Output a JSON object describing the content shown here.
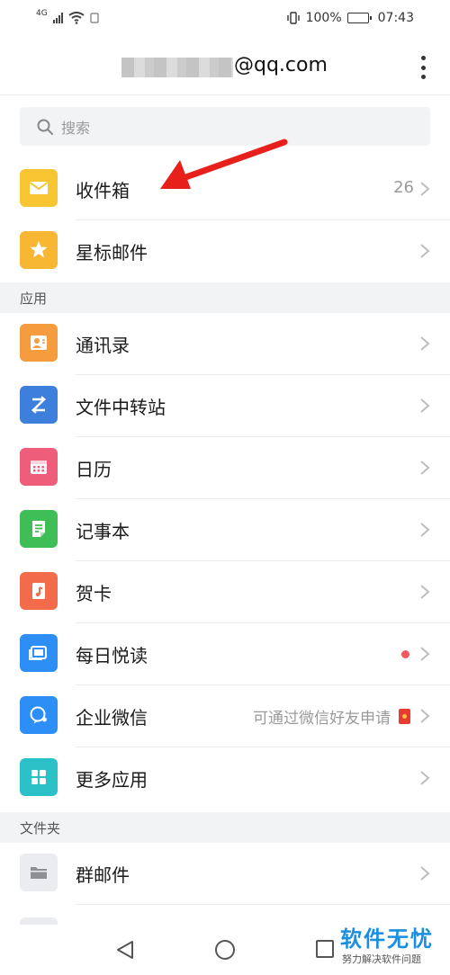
{
  "status_bar": {
    "network": "4G",
    "battery_percent": "100%",
    "time": "07:43"
  },
  "header": {
    "email_suffix": "@qq.com",
    "more_icon": "more-vertical-icon"
  },
  "search": {
    "placeholder": "搜索"
  },
  "mailbox": [
    {
      "label": "收件箱",
      "count": "26",
      "icon": "envelope-icon",
      "color": "#f6c531"
    },
    {
      "label": "星标邮件",
      "icon": "star-icon",
      "color": "#f7b733"
    }
  ],
  "apps_section": {
    "title": "应用",
    "items": [
      {
        "label": "通讯录",
        "icon": "contact-card-icon",
        "color": "#f49c3e"
      },
      {
        "label": "文件中转站",
        "icon": "transfer-icon",
        "color": "#3f7fdc"
      },
      {
        "label": "日历",
        "icon": "calendar-icon",
        "color": "#ee5d7a"
      },
      {
        "label": "记事本",
        "icon": "notepad-icon",
        "color": "#3fbd57"
      },
      {
        "label": "贺卡",
        "icon": "greeting-card-icon",
        "color": "#f26b4b"
      },
      {
        "label": "每日悦读",
        "icon": "reading-icon",
        "color": "#2d8ef5",
        "badge": "red-dot",
        "badge_color": "#f05a5a"
      },
      {
        "label": "企业微信",
        "icon": "wecom-icon",
        "color": "#2d8ef5",
        "hint": "可通过微信好友申请",
        "hint_icon": "red-envelope-icon"
      },
      {
        "label": "更多应用",
        "icon": "grid-icon",
        "color": "#2cc0c7"
      }
    ]
  },
  "folders_section": {
    "title": "文件夹",
    "items": [
      {
        "label": "群邮件",
        "icon": "folder-icon",
        "color": "#ebecef"
      }
    ]
  },
  "nav_bar": {
    "back_icon": "back-triangle-icon",
    "home_icon": "home-circle-icon",
    "recents_icon": "recents-square-icon"
  },
  "watermark": {
    "title": "软件无忧",
    "subtitle": "努力解决软件问题"
  },
  "annotation": {
    "arrow_color": "#e8201c"
  }
}
